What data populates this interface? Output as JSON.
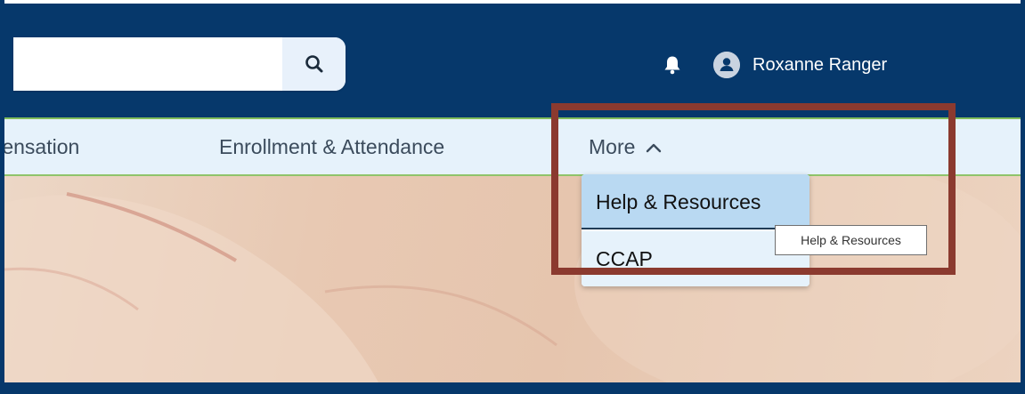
{
  "header": {
    "search": {
      "value": "",
      "placeholder": "",
      "button_icon": "search-icon"
    },
    "notifications_icon": "bell-icon",
    "user": {
      "avatar_icon": "user-avatar-icon",
      "name": "Roxanne Ranger"
    }
  },
  "nav": {
    "items": [
      {
        "label": "Compensation"
      },
      {
        "label": "Enrollment & Attendance"
      },
      {
        "label": "More",
        "icon": "chevron-up-icon",
        "expanded": true
      }
    ]
  },
  "dropdown": {
    "items": [
      {
        "label": "Help & Resources",
        "highlighted": true
      },
      {
        "label": "CCAP"
      }
    ]
  },
  "tooltip": {
    "text": "Help & Resources"
  },
  "colors": {
    "header_bg": "#06386b",
    "nav_bg": "#e6f2fb",
    "nav_border": "#8fc46a",
    "dropdown_highlight": "#b9d9f2",
    "annotation_box": "#8b3a2f"
  }
}
